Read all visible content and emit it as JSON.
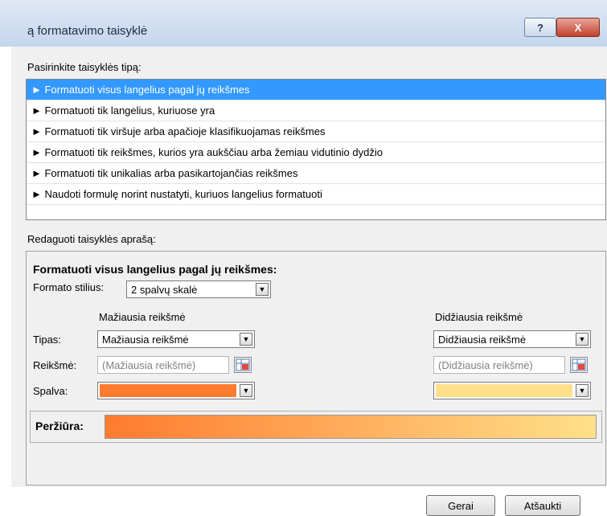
{
  "window": {
    "title": "ą formatavimo taisyklė",
    "help_label": "?",
    "close_label": "X"
  },
  "rule_type": {
    "label": "Pasirinkite taisyklės tipą:",
    "items": [
      {
        "label": "► Formatuoti visus langelius pagal jų reikšmes",
        "selected": true
      },
      {
        "label": "► Formatuoti tik langelius, kuriuose yra",
        "selected": false
      },
      {
        "label": "► Formatuoti tik viršuje arba apačioje klasifikuojamas reikšmes",
        "selected": false
      },
      {
        "label": "► Formatuoti tik reikšmes, kurios yra aukščiau arba žemiau vidutinio dydžio",
        "selected": false
      },
      {
        "label": "► Formatuoti tik unikalias arba pasikartojančias reikšmes",
        "selected": false
      },
      {
        "label": "► Naudoti formulę norint nustatyti, kuriuos langelius formatuoti",
        "selected": false
      }
    ]
  },
  "edit": {
    "label": "Redaguoti taisyklės aprašą:",
    "heading": "Formatuoti visus langelius pagal jų reikšmes:",
    "format_style_label": "Formato stilius:",
    "format_style_value": "2 spalvų skalė",
    "min_header": "Mažiausia reikšmė",
    "max_header": "Didžiausia reikšmė",
    "type_label": "Tipas:",
    "value_label": "Reikšmė:",
    "color_label": "Spalva:",
    "min_type": "Mažiausia reikšmė",
    "max_type": "Didžiausia reikšmė",
    "min_value_placeholder": "(Mažiausia reikšmė)",
    "max_value_placeholder": "(Didžiausia reikšmė)",
    "min_color": "#ff7b2e",
    "max_color": "#ffe08a",
    "preview_label": "Peržiūra:"
  },
  "buttons": {
    "ok": "Gerai",
    "cancel": "Atšaukti"
  }
}
